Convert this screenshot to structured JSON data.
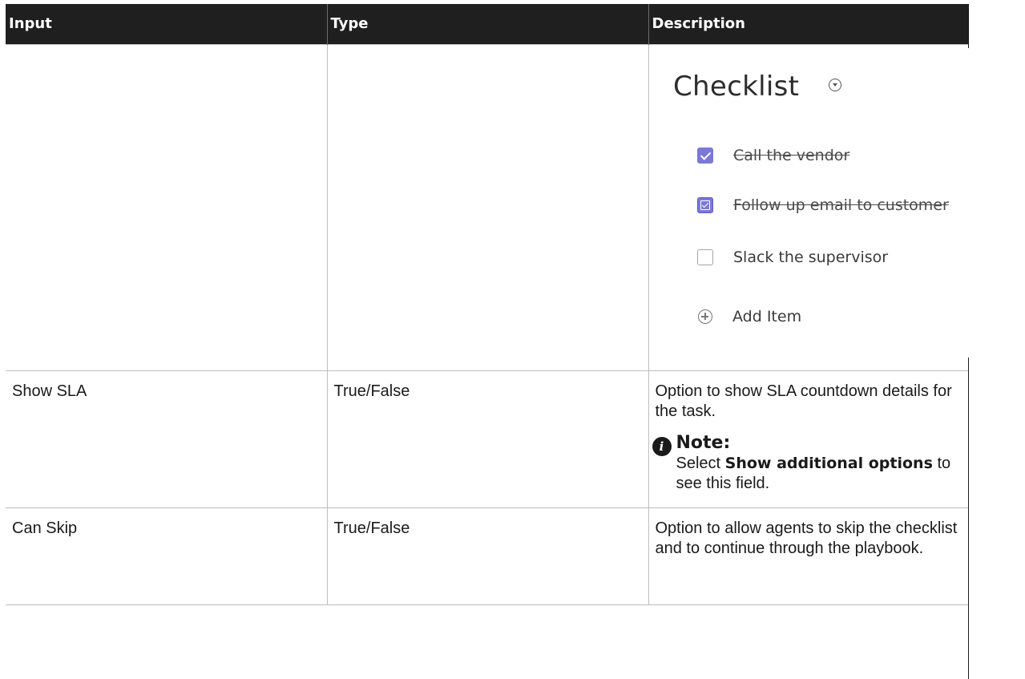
{
  "table": {
    "headers": {
      "input": "Input",
      "type": "Type",
      "description": "Description"
    },
    "rows": [
      {
        "input": "",
        "type": "",
        "description": ""
      },
      {
        "input": "Show SLA",
        "type": "True/False",
        "description": "Option to show SLA countdown details for the task."
      },
      {
        "input": "Can Skip",
        "type": "True/False",
        "description": "Option to allow agents to skip the checklist and to continue through the playbook."
      }
    ]
  },
  "checklist_preview": {
    "title": "Checklist",
    "items": [
      {
        "label": "Call the vendor",
        "state": "checked"
      },
      {
        "label": "Follow up email to customer",
        "state": "checked"
      },
      {
        "label": "Slack the supervisor",
        "state": "unchecked"
      }
    ],
    "add_label": "Add Item",
    "accent_color": "#7b78d8"
  },
  "note": {
    "icon": "info-icon",
    "title": "Note:",
    "text_before": "Select",
    "bold_text": "Show additional options",
    "text_after": "to see this field."
  }
}
